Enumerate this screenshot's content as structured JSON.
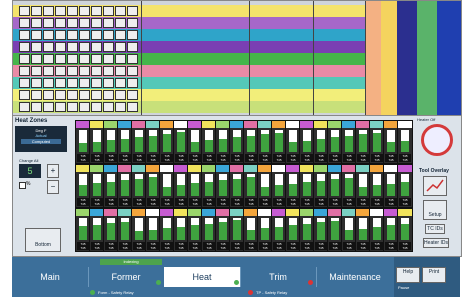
{
  "zones_header": {
    "title": "Heat Zones",
    "mode_label": "Deg F",
    "actual_label": "Actual",
    "computed_label": "Computed"
  },
  "change_all": {
    "label": "Change All",
    "value": "5",
    "plus": "+",
    "minus": "−",
    "percent": "%"
  },
  "heater_off": {
    "label": "Heater Off"
  },
  "tool_overlay": {
    "label": "Tool Overlay",
    "setup_label": "Setup",
    "tc_ids_label": "TC IDs",
    "heater_ids_label": "Heater IDs"
  },
  "bottom": {
    "button_label": "Bottom"
  },
  "nav": {
    "status_label": "Indexing",
    "tabs": [
      "Main",
      "Former",
      "Heat",
      "Trim",
      "Maintenance"
    ],
    "legend_left": "Form - Safety Relay",
    "legend_right": "TP - Safety Relay"
  },
  "help": {
    "help_label": "Help",
    "print_label": "Print",
    "pause_label": "Pause"
  },
  "zone_values_row": "745"
}
